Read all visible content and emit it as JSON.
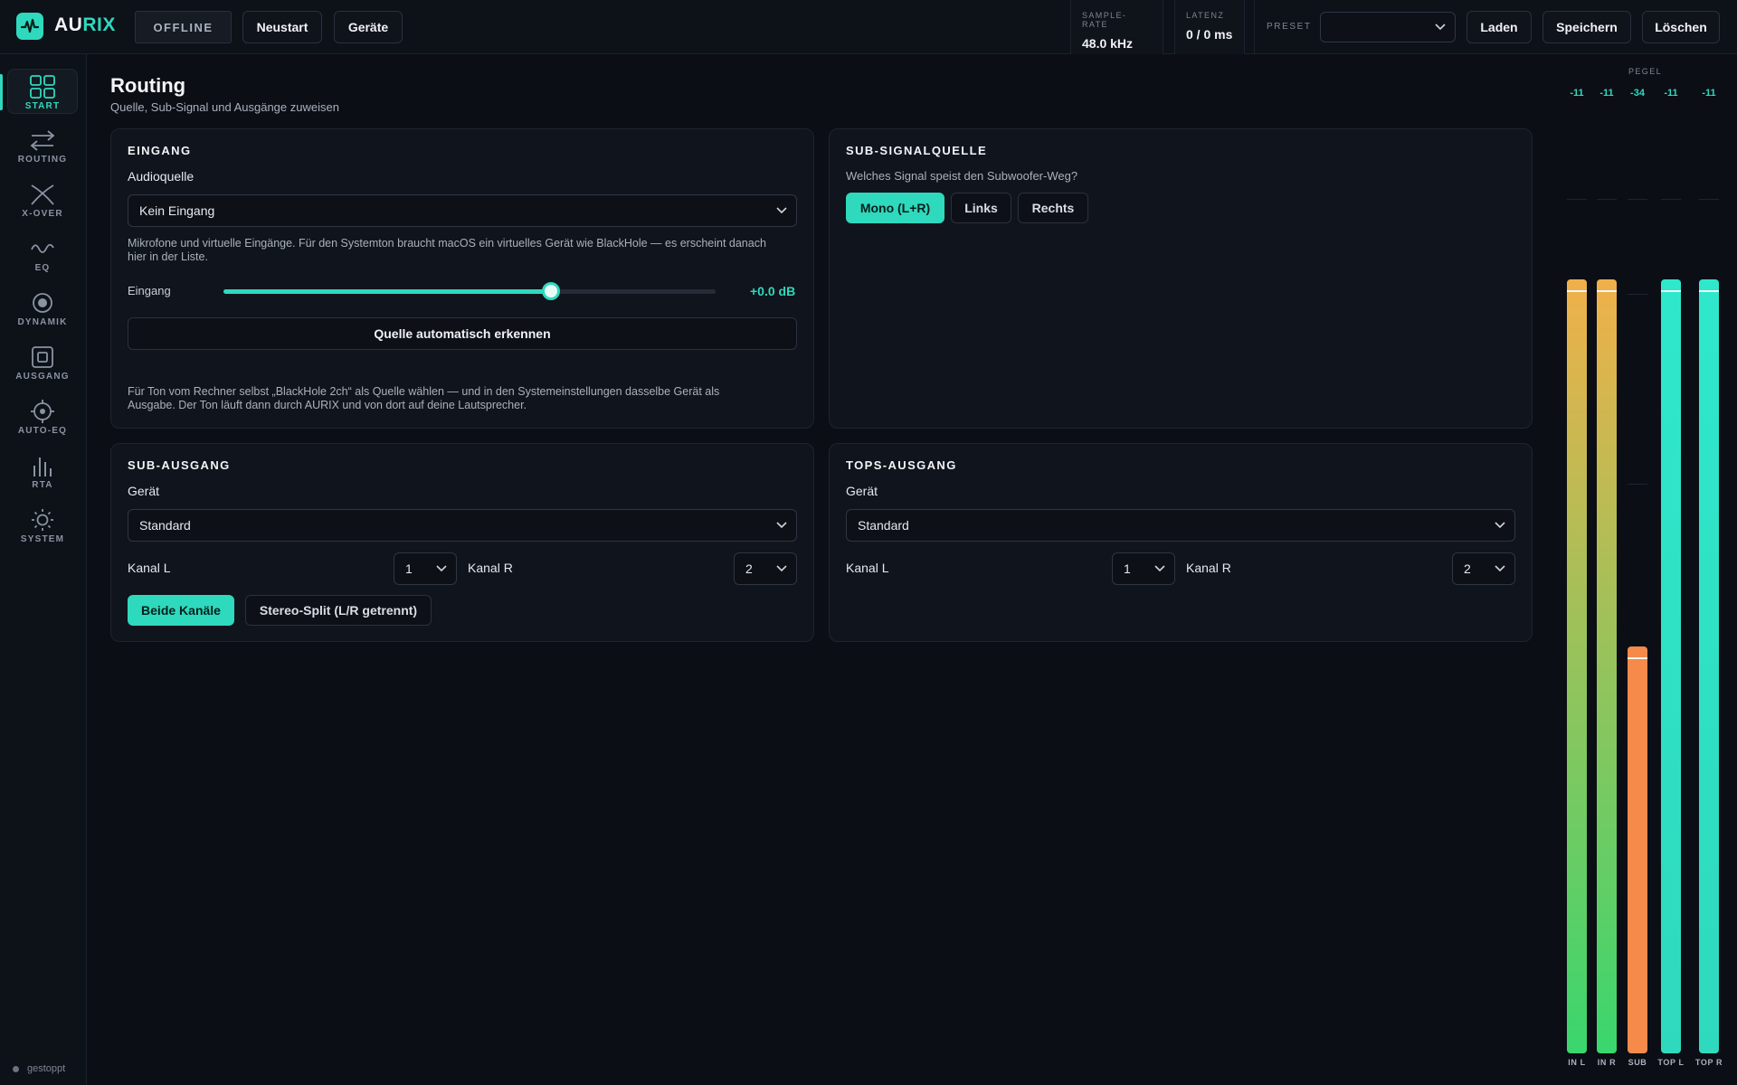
{
  "app": {
    "logo_prefix": "AU",
    "logo_suffix": "RIX",
    "status_badge": "OFFLINE",
    "restart_label": "Neustart",
    "devices_label": "Geräte"
  },
  "stats": {
    "sample_rate_label": "SAMPLE-RATE",
    "sample_rate_value": "48.0 kHz",
    "latency_label": "LATENZ",
    "latency_value": "0 / 0 ms"
  },
  "preset": {
    "label": "PRESET",
    "selected": "",
    "load_label": "Laden",
    "save_label": "Speichern",
    "delete_label": "Löschen"
  },
  "sidebar": {
    "items": [
      {
        "label": "START",
        "icon": "grid-icon",
        "active": true
      },
      {
        "label": "ROUTING",
        "icon": "arrows-icon",
        "active": false
      },
      {
        "label": "X-OVER",
        "icon": "crossover-icon",
        "active": false
      },
      {
        "label": "EQ",
        "icon": "wave-icon",
        "active": false
      },
      {
        "label": "DYNAMIK",
        "icon": "target-icon",
        "active": false
      },
      {
        "label": "AUSGANG",
        "icon": "square-icon",
        "active": false
      },
      {
        "label": "AUTO-EQ",
        "icon": "crosshair-icon",
        "active": false
      },
      {
        "label": "RTA",
        "icon": "bars-icon",
        "active": false
      },
      {
        "label": "SYSTEM",
        "icon": "sun-icon",
        "active": false
      }
    ],
    "status_text": "gestoppt"
  },
  "page": {
    "title": "Routing",
    "subtitle": "Quelle, Sub-Signal und Ausgänge zuweisen"
  },
  "input_card": {
    "title": "EINGANG",
    "source_label": "Audioquelle",
    "source_value": "Kein Eingang",
    "hint_line1": "Mikrofone und virtuelle Eingänge. Für den Systemton braucht macOS ein virtuelles Gerät wie BlackHole — es erscheint danach",
    "hint_line2": "hier in der Liste.",
    "gain_label": "Eingang",
    "gain_value": "+0.0 dB",
    "gain_fraction": 0.665,
    "auto_detect_label": "Quelle automatisch erkennen",
    "footer_line1": "Für Ton vom Rechner selbst „BlackHole 2ch“ als Quelle wählen — und in den Systemeinstellungen dasselbe Gerät als",
    "footer_line2": "Ausgabe. Der Ton läuft dann durch AURIX und von dort auf deine Lautsprecher."
  },
  "sub_source_card": {
    "title": "SUB-SIGNALQUELLE",
    "question": "Welches Signal speist den Subwoofer-Weg?",
    "options": [
      "Mono (L+R)",
      "Links",
      "Rechts"
    ],
    "selected": "Mono (L+R)"
  },
  "sub_out_card": {
    "title": "SUB-AUSGANG",
    "device_label": "Gerät",
    "device_value": "Standard",
    "left_label": "Kanal L",
    "left_value": "1",
    "right_label": "Kanal R",
    "right_value": "2",
    "mode_both": "Beide Kanäle",
    "mode_split": "Stereo-Split (L/R getrennt)",
    "selected_mode": "Beide Kanäle"
  },
  "tops_out_card": {
    "title": "TOPS-AUSGANG",
    "device_label": "Gerät",
    "device_value": "Standard",
    "left_label": "Kanal L",
    "left_value": "1",
    "right_label": "Kanal R",
    "right_value": "2"
  },
  "meters": {
    "header": "PEGEL",
    "channels": [
      {
        "name": "IN L",
        "value": "-11",
        "level": 0.99,
        "color": "#f0b04a",
        "value_color": "#2fd9bd"
      },
      {
        "name": "IN R",
        "value": "-11",
        "level": 0.99,
        "color": "#f0b04a",
        "value_color": "#2fd9bd"
      },
      {
        "name": "SUB",
        "value": "-34",
        "level": 0.52,
        "color": "#f58a4a",
        "value_color": "#2fd9bd"
      },
      {
        "name": "TOP L",
        "value": "-11",
        "level": 0.99,
        "color": "#2fe8cc",
        "value_color": "#2fd9bd"
      },
      {
        "name": "TOP R",
        "value": "-11",
        "level": 0.99,
        "color": "#2fe8cc",
        "value_color": "#2fd9bd"
      }
    ]
  },
  "colors": {
    "accent": "#2fd9bd",
    "background": "#0b0e14",
    "card": "#10141c"
  }
}
